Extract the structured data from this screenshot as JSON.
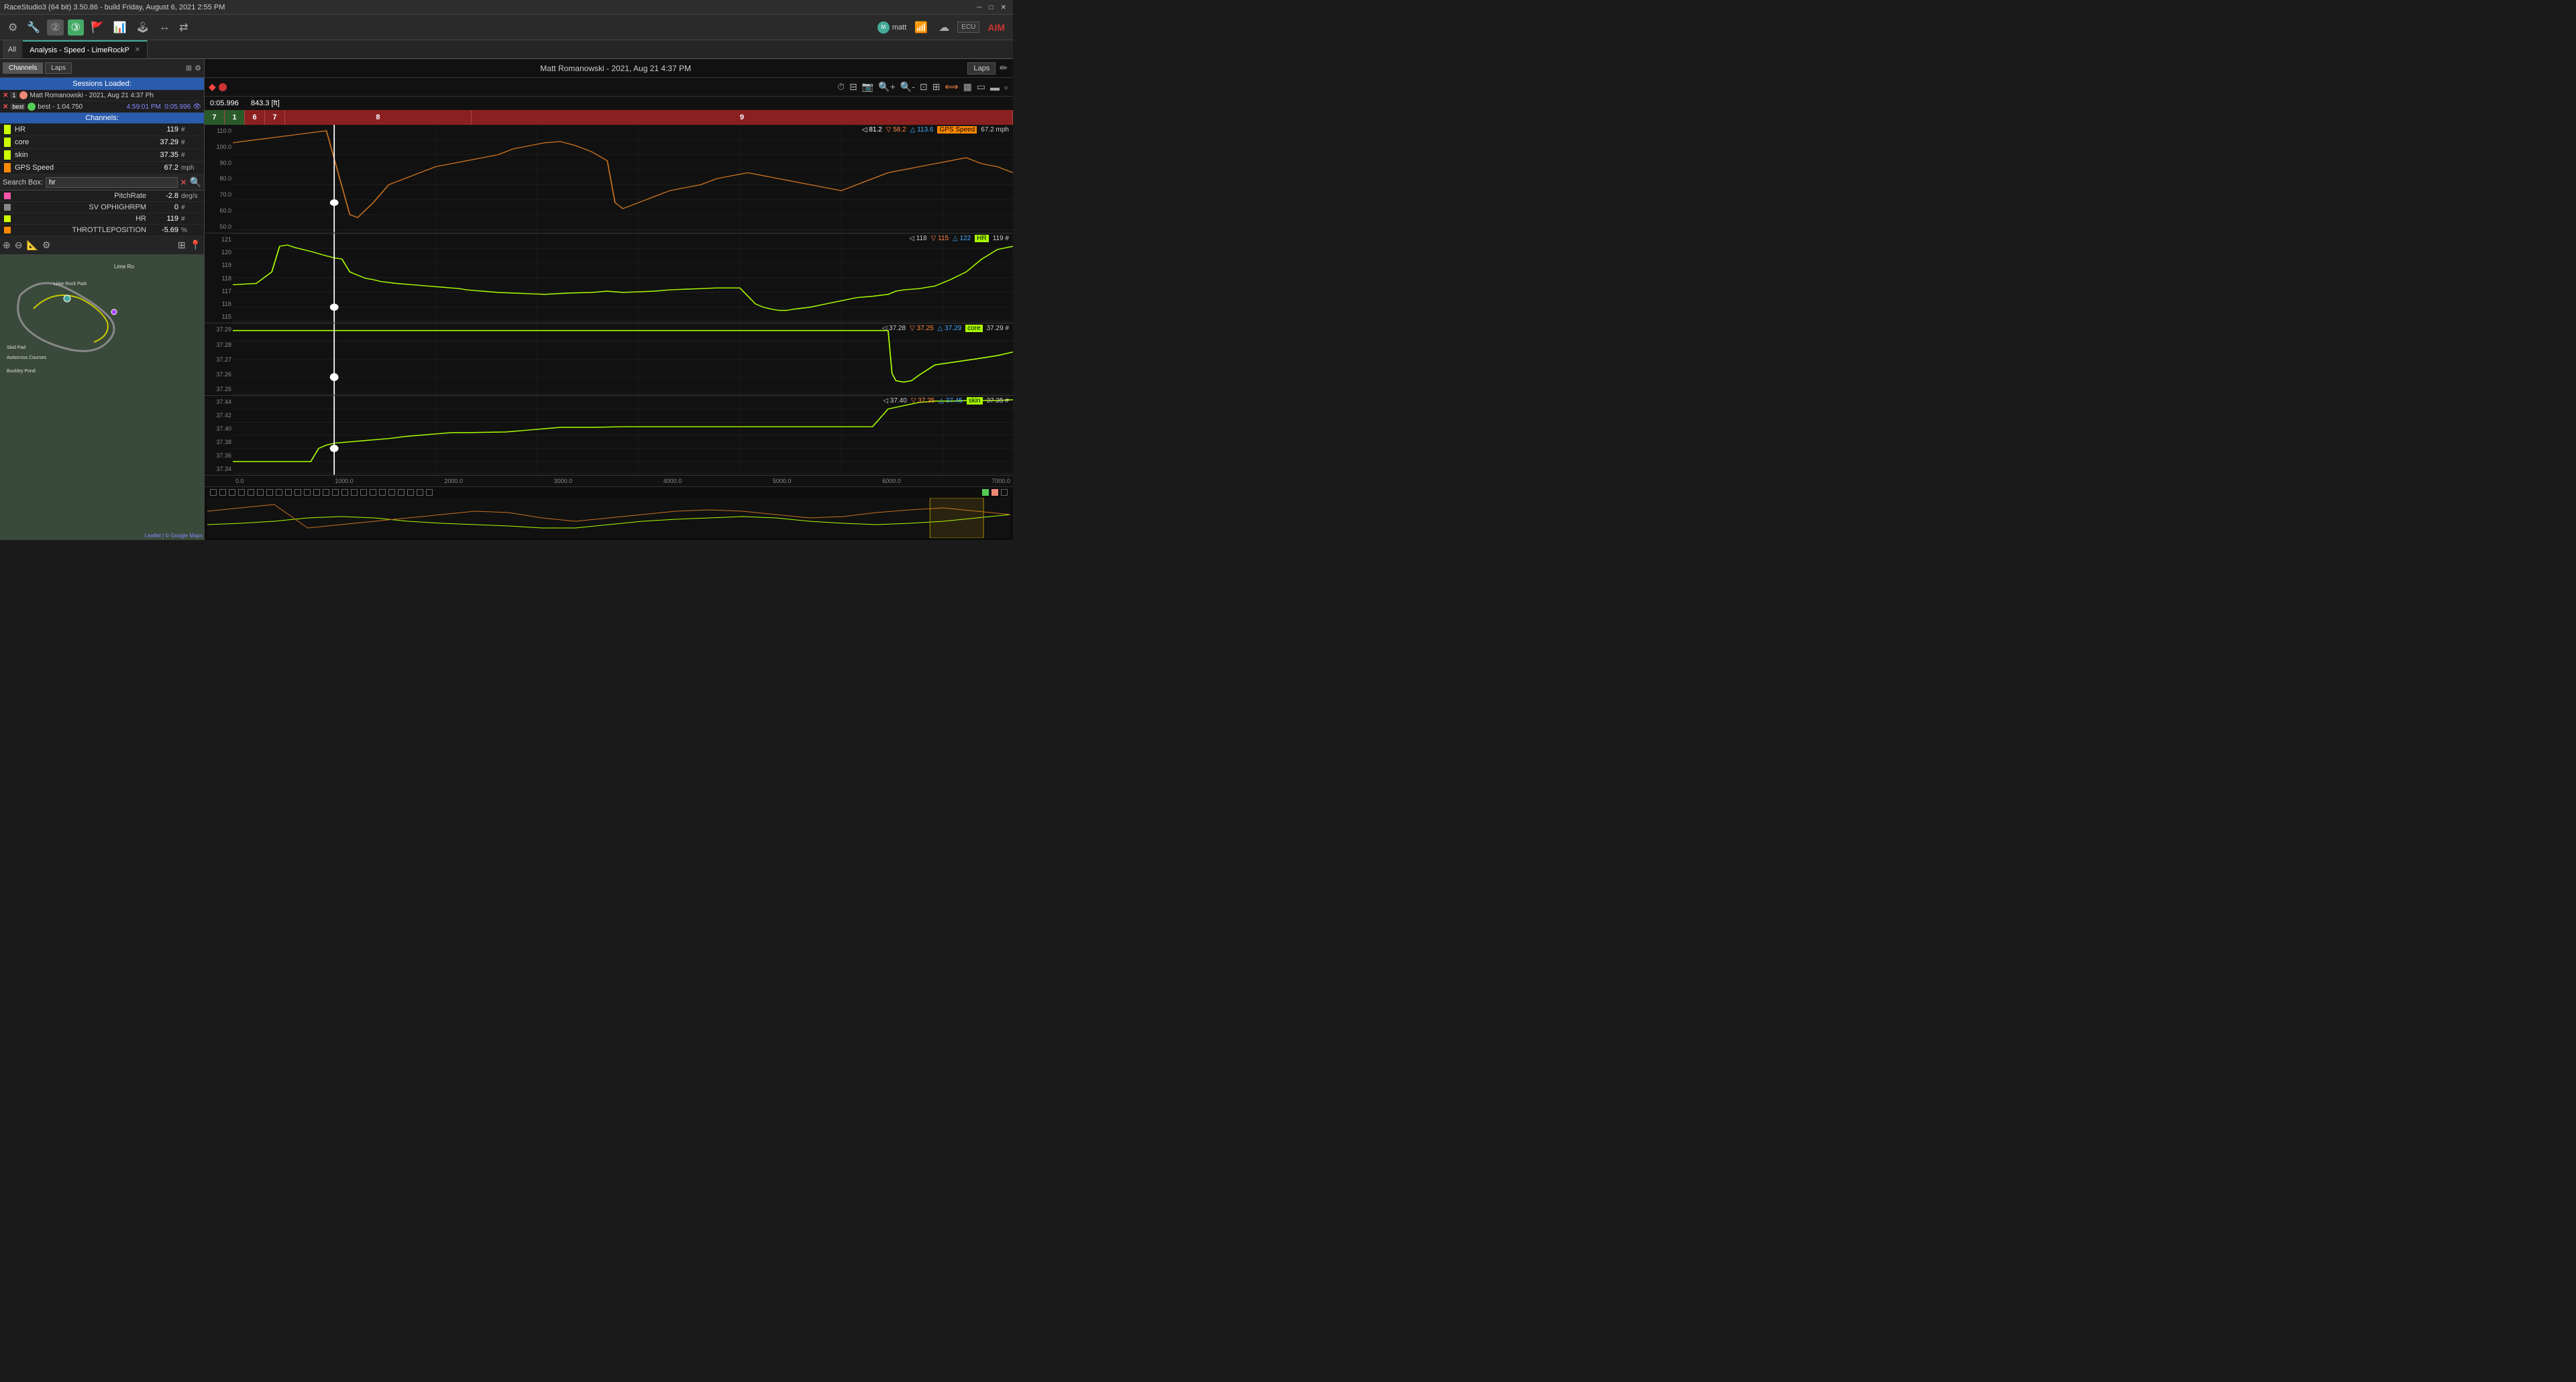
{
  "app": {
    "title": "RaceStudio3 (64 bit) 3.50.86 - build Friday, August 6, 2021 2:55 PM",
    "user": "matt"
  },
  "tabs": [
    {
      "id": "analysis",
      "label": "Analysis - Speed - LimeRockP",
      "closable": true,
      "active": true
    }
  ],
  "left": {
    "tabs": [
      "Channels",
      "Laps"
    ],
    "sessions_label": "Sessions Loaded:",
    "sessions": [
      {
        "id": 1,
        "number": "1",
        "color": "orange",
        "name": "Matt Romanowski - 2021, Aug 21 4:37 Ph",
        "time": "",
        "has_eye": false
      },
      {
        "id": 2,
        "number": "best",
        "color": "green",
        "name": "best - 1:04.750",
        "time": "4:59:01 PM  0:05.996",
        "has_eye": true
      }
    ],
    "channels_label": "Channels:",
    "channels": [
      {
        "id": "HR",
        "name": "HR",
        "value": "119",
        "unit": "#",
        "color": "lime"
      },
      {
        "id": "core",
        "name": "core",
        "value": "37.29",
        "unit": "#",
        "color": "lime"
      },
      {
        "id": "skin",
        "name": "skin",
        "value": "37.35",
        "unit": "#",
        "color": "lime"
      },
      {
        "id": "GPS Speed",
        "name": "GPS Speed",
        "value": "67.2",
        "unit": "mph",
        "color": "orange"
      }
    ],
    "search": {
      "label": "Search Box:",
      "value": "hr",
      "placeholder": "hr"
    },
    "search_results": [
      {
        "name": "PitchRate",
        "value": "-2.8",
        "unit": "deg/s",
        "color": "pink"
      },
      {
        "name": "SV OPHIGHRPM",
        "value": "0",
        "unit": "#",
        "color": "none"
      },
      {
        "name": "HR",
        "value": "119",
        "unit": "#",
        "color": "lime"
      },
      {
        "name": "THROTTLEPOSITION",
        "value": "-5.69",
        "unit": "%",
        "color": "orange"
      }
    ],
    "map": {
      "labels": [
        "Lime Ro",
        "Lime Rock Park",
        "Skid Pad",
        "Autocross Courses",
        "Buckley Pond"
      ],
      "credit": "Leaflet | © Google Maps"
    }
  },
  "chart": {
    "header_title": "Matt Romanowski - 2021, Aug 21 4:37 PM",
    "laps_btn": "Laps",
    "time_indicator": "0:05.996",
    "distance_indicator": "843.3 [ft]",
    "lap_numbers": [
      "7",
      "1",
      "6",
      "7",
      "8",
      "9"
    ],
    "cursor_pos_pct": 13,
    "panels": [
      {
        "id": "gps_speed",
        "label": "GPS Speed",
        "unit": "mph",
        "color": "#c87020",
        "y_min": 0,
        "y_max": 110,
        "y_labels": [
          "110.0",
          "100.0",
          "90.0",
          "80.0",
          "70.0",
          "60.0",
          "50.0"
        ],
        "indicators": {
          "left": "81.2",
          "down": "58.2",
          "up": "113.6",
          "current": "67.2 mph"
        }
      },
      {
        "id": "HR",
        "label": "HR",
        "unit": "#",
        "color": "#aaff00",
        "y_min": 114,
        "y_max": 122,
        "y_labels": [
          "121",
          "120",
          "119",
          "118",
          "117",
          "116",
          "115"
        ],
        "indicators": {
          "left": "118",
          "down": "115",
          "up": "122",
          "current": "119 #"
        }
      },
      {
        "id": "core",
        "label": "core",
        "unit": "#",
        "color": "#aaff00",
        "y_min": 37.24,
        "y_max": 37.3,
        "y_labels": [
          "37.29",
          "37.28",
          "37.27",
          "37.26",
          "37.25"
        ],
        "indicators": {
          "left": "37.28",
          "down": "37.25",
          "up": "37.29",
          "current": "37.29 #"
        }
      },
      {
        "id": "skin",
        "label": "skin",
        "unit": "#",
        "color": "#aaff00",
        "y_min": 37.33,
        "y_max": 37.46,
        "y_labels": [
          "37.44",
          "37.42",
          "37.40",
          "37.38",
          "37.36",
          "37.34"
        ],
        "indicators": {
          "left": "37.40",
          "down": "37.35",
          "up": "37.45",
          "current": "37.35 #"
        }
      }
    ],
    "x_labels": [
      "0.0",
      "1000.0",
      "2000.0",
      "3000.0",
      "4000.0",
      "5000.0",
      "6000.0",
      "7000.0"
    ]
  },
  "icons": {
    "settings": "⚙",
    "search": "🔍",
    "layers": "⊞",
    "zoom_in": "+",
    "zoom_out": "−",
    "refresh": "↺",
    "arrow_left": "◁",
    "arrow_right": "▷",
    "pencil": "✏",
    "circle_dot": "●",
    "record": "⏺",
    "clock": "⏱",
    "camera": "📷",
    "zoom_fit": "⊡",
    "measure": "⟺",
    "cursor": "⊕"
  }
}
